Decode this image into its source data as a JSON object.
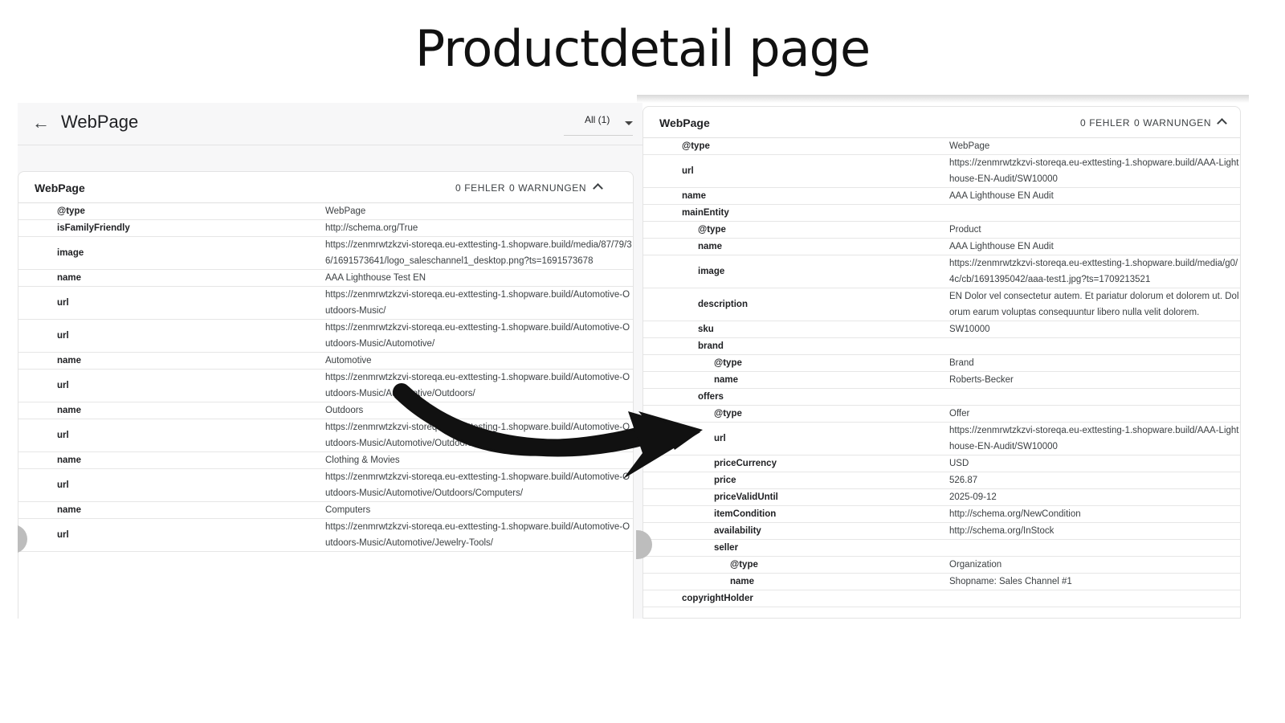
{
  "page_title": "Productdetail page",
  "left": {
    "header_title": "WebPage",
    "filter_label": "All (1)",
    "card": {
      "title": "WebPage",
      "errors": "0 FEHLER",
      "warnings": "0 WARNUNGEN",
      "rows": [
        {
          "key": "@type",
          "value": "WebPage",
          "indent": 0
        },
        {
          "key": "isFamilyFriendly",
          "value": "http://schema.org/True",
          "indent": 0
        },
        {
          "key": "image",
          "value": "https://zenmrwtzkzvi-storeqa.eu-exttesting-1.shopware.build/media/87/79/36/1691573641/logo_saleschannel1_desktop.png?ts=1691573678",
          "indent": 0
        },
        {
          "key": "name",
          "value": "AAA Lighthouse Test EN",
          "indent": 0
        },
        {
          "key": "url",
          "value": "https://zenmrwtzkzvi-storeqa.eu-exttesting-1.shopware.build/Automotive-Outdoors-Music/",
          "indent": 0
        },
        {
          "key": "url",
          "value": "https://zenmrwtzkzvi-storeqa.eu-exttesting-1.shopware.build/Automotive-Outdoors-Music/Automotive/",
          "indent": 0
        },
        {
          "key": "name",
          "value": "Automotive",
          "indent": 0
        },
        {
          "key": "url",
          "value": "https://zenmrwtzkzvi-storeqa.eu-exttesting-1.shopware.build/Automotive-Outdoors-Music/Automotive/Outdoors/",
          "indent": 0
        },
        {
          "key": "name",
          "value": "Outdoors",
          "indent": 0
        },
        {
          "key": "url",
          "value": "https://zenmrwtzkzvi-storeqa.eu-exttesting-1.shopware.build/Automotive-Outdoors-Music/Automotive/Outdoors/Clothing-Movies/",
          "indent": 0
        },
        {
          "key": "name",
          "value": "Clothing & Movies",
          "indent": 0
        },
        {
          "key": "url",
          "value": "https://zenmrwtzkzvi-storeqa.eu-exttesting-1.shopware.build/Automotive-Outdoors-Music/Automotive/Outdoors/Computers/",
          "indent": 0
        },
        {
          "key": "name",
          "value": "Computers",
          "indent": 0
        },
        {
          "key": "url",
          "value": "https://zenmrwtzkzvi-storeqa.eu-exttesting-1.shopware.build/Automotive-Outdoors-Music/Automotive/Jewelry-Tools/",
          "indent": 0
        }
      ]
    }
  },
  "right": {
    "card": {
      "title": "WebPage",
      "errors": "0 FEHLER",
      "warnings": "0 WARNUNGEN",
      "rows": [
        {
          "key": "@type",
          "value": "WebPage",
          "indent": 1
        },
        {
          "key": "url",
          "value": "https://zenmrwtzkzvi-storeqa.eu-exttesting-1.shopware.build/AAA-Lighthouse-EN-Audit/SW10000",
          "indent": 1
        },
        {
          "key": "name",
          "value": "AAA Lighthouse EN Audit",
          "indent": 1
        },
        {
          "key": "mainEntity",
          "value": "",
          "indent": 1
        },
        {
          "key": "@type",
          "value": "Product",
          "indent": 2
        },
        {
          "key": "name",
          "value": "AAA Lighthouse EN Audit",
          "indent": 2
        },
        {
          "key": "image",
          "value": "https://zenmrwtzkzvi-storeqa.eu-exttesting-1.shopware.build/media/g0/4c/cb/1691395042/aaa-test1.jpg?ts=1709213521",
          "indent": 2
        },
        {
          "key": "description",
          "value": "EN Dolor vel consectetur autem. Et pariatur dolorum et dolorem ut. Dolorum earum voluptas consequuntur libero nulla velit dolorem.",
          "indent": 2
        },
        {
          "key": "sku",
          "value": "SW10000",
          "indent": 2
        },
        {
          "key": "brand",
          "value": "",
          "indent": 2
        },
        {
          "key": "@type",
          "value": "Brand",
          "indent": 3
        },
        {
          "key": "name",
          "value": "Roberts-Becker",
          "indent": 3
        },
        {
          "key": "offers",
          "value": "",
          "indent": 2
        },
        {
          "key": "@type",
          "value": "Offer",
          "indent": 3
        },
        {
          "key": "url",
          "value": "https://zenmrwtzkzvi-storeqa.eu-exttesting-1.shopware.build/AAA-Lighthouse-EN-Audit/SW10000",
          "indent": 3
        },
        {
          "key": "priceCurrency",
          "value": "USD",
          "indent": 3
        },
        {
          "key": "price",
          "value": "526.87",
          "indent": 3
        },
        {
          "key": "priceValidUntil",
          "value": "2025-09-12",
          "indent": 3
        },
        {
          "key": "itemCondition",
          "value": "http://schema.org/NewCondition",
          "indent": 3
        },
        {
          "key": "availability",
          "value": "http://schema.org/InStock",
          "indent": 3
        },
        {
          "key": "seller",
          "value": "",
          "indent": 3
        },
        {
          "key": "@type",
          "value": "Organization",
          "indent": 4
        },
        {
          "key": "name",
          "value": "Shopname: Sales Channel #1",
          "indent": 4
        },
        {
          "key": "copyrightHolder",
          "value": "",
          "indent": 1
        }
      ]
    }
  },
  "icons": {
    "back": "arrow-left-icon",
    "filter": "caret-down-icon",
    "collapse": "chevron-up-icon",
    "annotation": "curved-arrow-icon"
  },
  "colors": {
    "text": "#202124",
    "muted": "#3c4043",
    "divider": "#e6e6e6",
    "panel_bg": "#f7f7f8",
    "arrow": "#111111"
  }
}
